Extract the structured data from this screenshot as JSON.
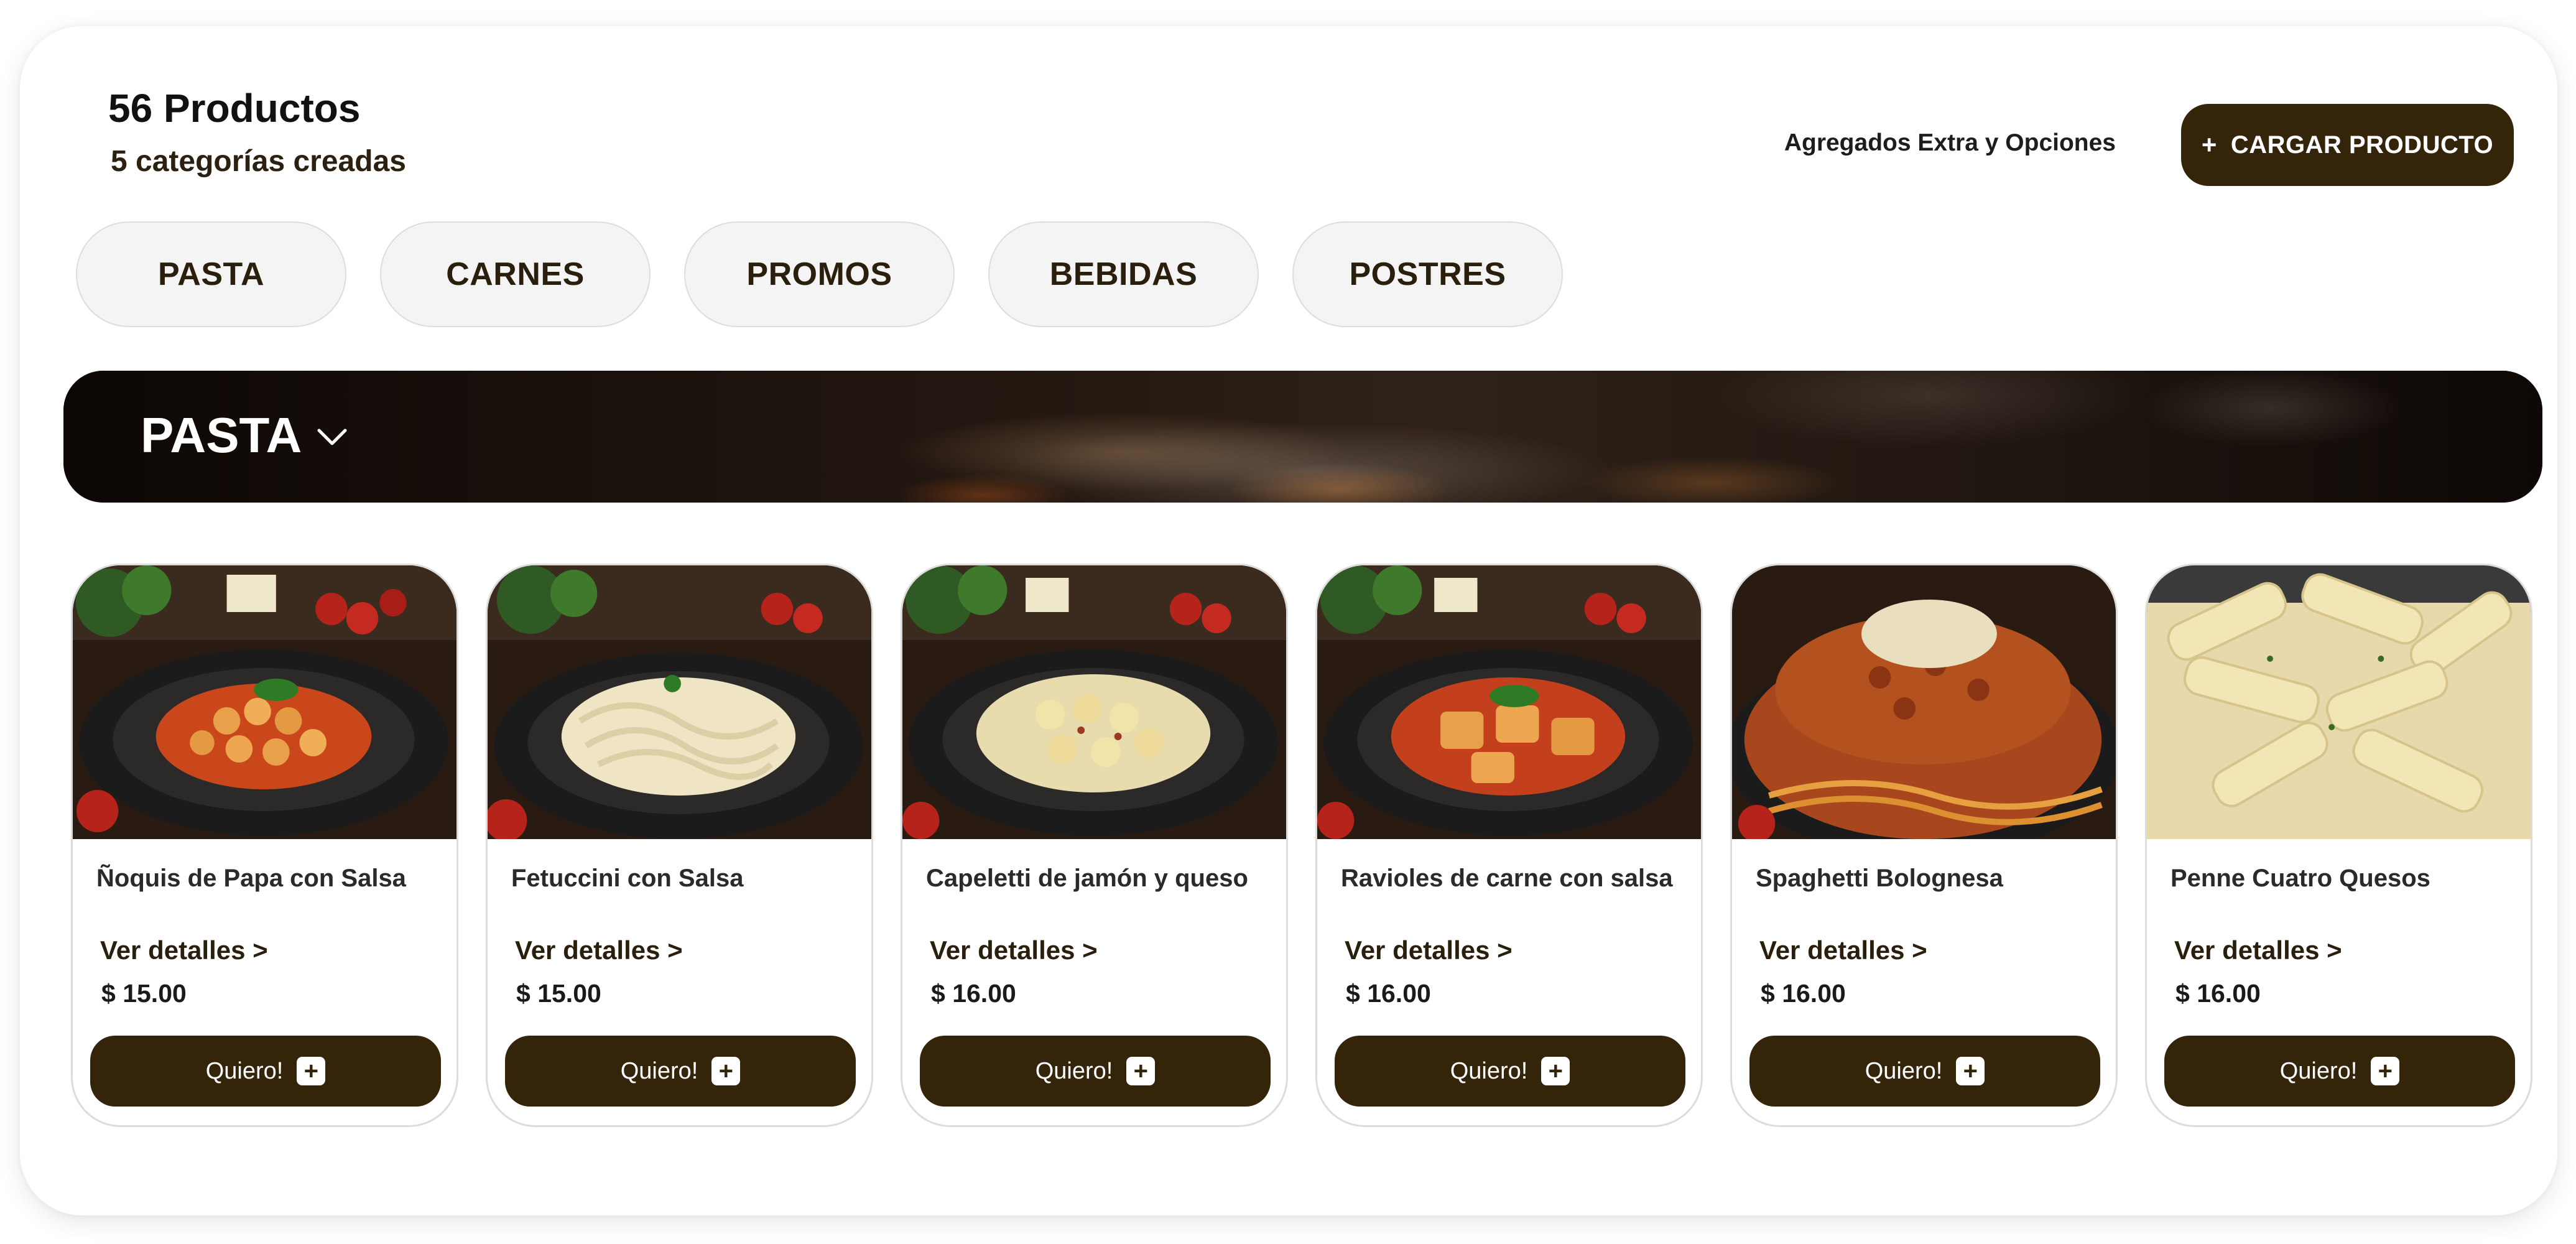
{
  "header": {
    "title": "56 Productos",
    "subtitle": "5 categorías creadas",
    "extras_label": "Agregados Extra y Opciones",
    "add_button_icon": "plus-icon",
    "add_button_label": "CARGAR PRODUCTO"
  },
  "categories": [
    "PASTA",
    "CARNES",
    "PROMOS",
    "BEBIDAS",
    "POSTRES"
  ],
  "section": {
    "title": "PASTA",
    "toggle_icon": "chevron-down-icon"
  },
  "products": [
    {
      "name": "Ñoquis de Papa con Salsa",
      "details": "Ver detalles >",
      "price": "$ 15.00",
      "button": "Quiero!",
      "image": "gnocchi-image"
    },
    {
      "name": "Fetuccini con Salsa",
      "details": "Ver detalles >",
      "price": "$ 15.00",
      "button": "Quiero!",
      "image": "fettuccine-image"
    },
    {
      "name": "Capeletti de jamón y queso",
      "details": "Ver detalles >",
      "price": "$ 16.00",
      "button": "Quiero!",
      "image": "cappelletti-image"
    },
    {
      "name": "Ravioles de carne con salsa",
      "details": "Ver detalles >",
      "price": "$ 16.00",
      "button": "Quiero!",
      "image": "ravioli-image"
    },
    {
      "name": "Spaghetti Bolognesa",
      "details": "Ver detalles >",
      "price": "$ 16.00",
      "button": "Quiero!",
      "image": "spaghetti-image"
    },
    {
      "name": "Penne Cuatro Quesos",
      "details": "Ver detalles >",
      "price": "$ 16.00",
      "button": "Quiero!",
      "image": "penne-image"
    }
  ],
  "colors": {
    "primary": "#33240a",
    "chip_background": "#f4f4f4",
    "banner_background": "#120b06",
    "card_border": "#dcdcdc"
  }
}
